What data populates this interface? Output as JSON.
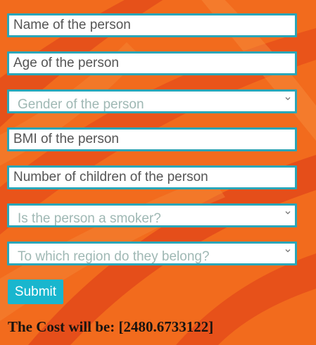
{
  "form": {
    "name_placeholder": "Name of the person",
    "age_placeholder": "Age of the person",
    "gender_placeholder": "Gender of the person",
    "bmi_placeholder": "BMI of the person",
    "children_placeholder": "Number of children of the person",
    "smoker_placeholder": "Is the person a smoker?",
    "region_placeholder": "To which region do they belong?",
    "submit_label": "Submit"
  },
  "result": {
    "text": "The Cost will be: [2480.6733122]"
  },
  "colors": {
    "background": "#f26b1d",
    "field_border": "#2aa6b8",
    "button": "#19b6ce"
  }
}
